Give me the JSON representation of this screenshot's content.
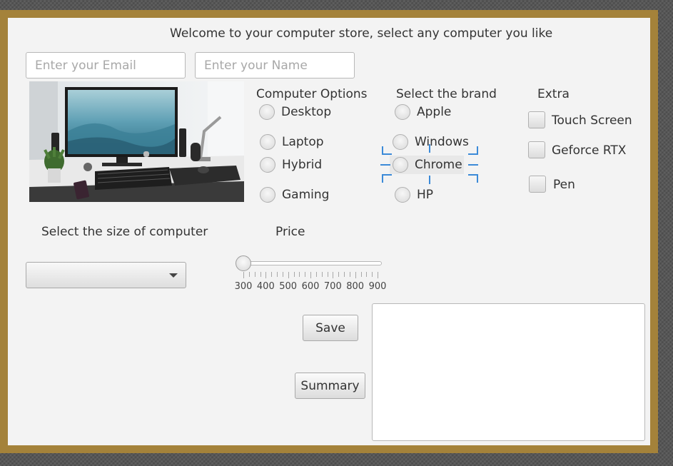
{
  "header": {
    "welcome": "Welcome to your computer store, select any computer you like"
  },
  "form": {
    "email_placeholder": "Enter your Email",
    "name_placeholder": "Enter your Name"
  },
  "options": {
    "title": "Computer Options",
    "items": [
      "Desktop",
      "Laptop",
      "Hybrid",
      "Gaming"
    ]
  },
  "brand": {
    "title": "Select the brand",
    "items": [
      "Apple",
      "Windows",
      "Chrome",
      "HP"
    ],
    "focused": "Chrome"
  },
  "extra": {
    "title": "Extra",
    "items": [
      "Touch Screen",
      "Geforce RTX",
      "Pen"
    ]
  },
  "size": {
    "label": "Select the size of computer",
    "selected": ""
  },
  "price": {
    "label": "Price",
    "ticks": [
      "300",
      "400",
      "500",
      "600",
      "700",
      "800",
      "900"
    ],
    "value": 300
  },
  "buttons": {
    "save": "Save",
    "summary": "Summary"
  },
  "summary_text": "",
  "colors": {
    "frame": "#a4823a",
    "panel": "#f3f3f3",
    "focus": "#3b8ad8"
  }
}
